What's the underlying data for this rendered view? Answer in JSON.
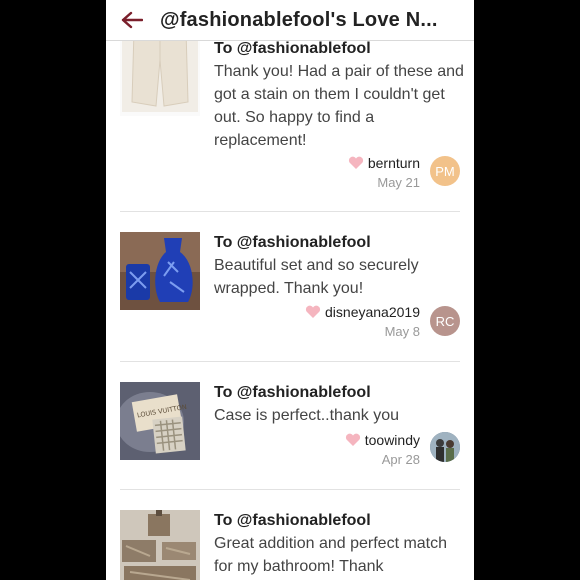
{
  "header": {
    "title": "@fashionablefool's Love N...",
    "back_icon": "back-arrow-icon",
    "accent": "#7a1f2b"
  },
  "items": [
    {
      "to": "To @fashionablefool",
      "message": "Thank you! Had a pair of these and got a stain on them I couldn't get out. So happy to find a replacement!",
      "username": "bernturn",
      "date": "May 21",
      "avatar_initials": "PM",
      "avatar_color": "#f2c28a"
    },
    {
      "to": "To @fashionablefool",
      "message": "Beautiful set and so securely wrapped. Thank you!",
      "username": "disneyana2019",
      "date": "May 8",
      "avatar_initials": "RC",
      "avatar_color": "#b8948d"
    },
    {
      "to": "To @fashionablefool",
      "message": "Case is perfect..thank you",
      "username": "toowindy",
      "date": "Apr 28",
      "avatar_initials": "",
      "avatar_color": "#6d7f8f"
    },
    {
      "to": "To @fashionablefool",
      "message": "Great addition and perfect match for my bathroom! Thank",
      "username": "",
      "date": "",
      "avatar_initials": "",
      "avatar_color": ""
    }
  ],
  "icons": {
    "heart": "heart-icon",
    "heart_color": "#f5b5bf"
  },
  "product_thumb_text": "LOUIS VUITTON"
}
